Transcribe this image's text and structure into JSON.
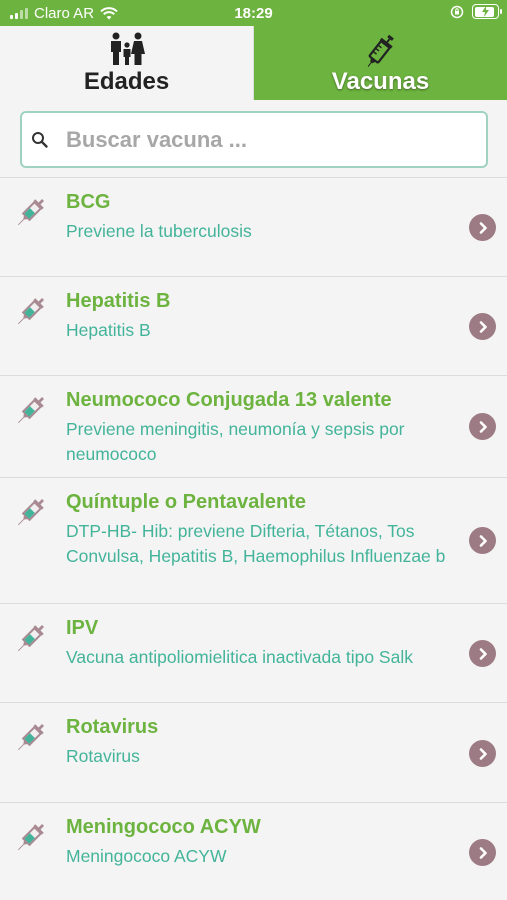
{
  "status": {
    "carrier": "Claro AR",
    "time": "18:29"
  },
  "tabs": [
    {
      "label": "Edades",
      "icon": "family-icon",
      "active": false
    },
    {
      "label": "Vacunas",
      "icon": "syringe-icon",
      "active": true
    }
  ],
  "search": {
    "placeholder": "Buscar vacuna ...",
    "value": ""
  },
  "vaccines": [
    {
      "name": "BCG",
      "description": "Previene la tuberculosis"
    },
    {
      "name": "Hepatitis B",
      "description": "Hepatitis B"
    },
    {
      "name": "Neumococo Conjugada 13 valente",
      "description": "Previene meningitis, neumonía y sepsis por neumococo"
    },
    {
      "name": "Quíntuple o Pentavalente",
      "description": "DTP-HB- Hib: previene Difteria, Tétanos, Tos Convulsa, Hepatitis B, Haemophilus Influenzae b"
    },
    {
      "name": "IPV",
      "description": "Vacuna antipoliomielitica inactivada tipo Salk"
    },
    {
      "name": "Rotavirus",
      "description": "Rotavirus"
    },
    {
      "name": "Meningococo ACYW",
      "description": "Meningococo ACYW"
    }
  ],
  "colors": {
    "brand_green": "#6db33f",
    "description_teal": "#43b49a",
    "chevron_mauve": "#9d7b85",
    "search_border": "#9fd2c2"
  }
}
